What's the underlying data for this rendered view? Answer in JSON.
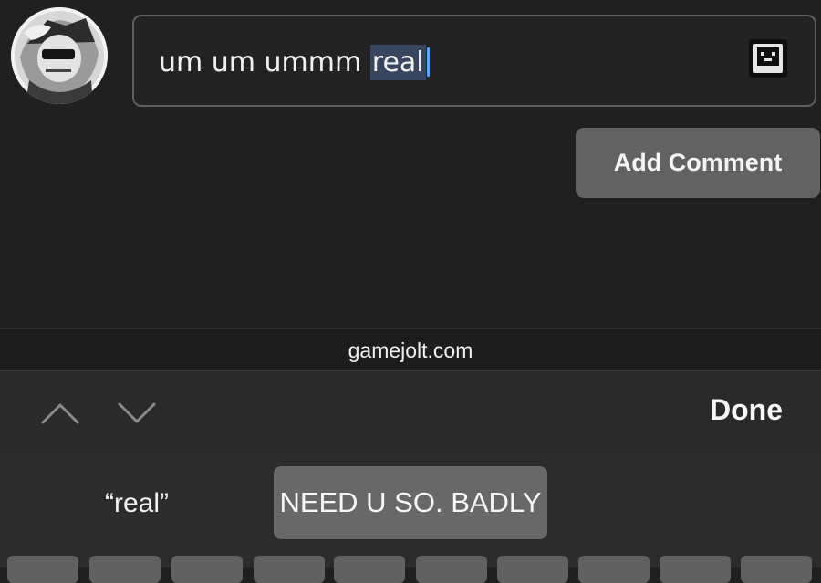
{
  "comment": {
    "text_before": "um um ummm ",
    "text_selected": "real"
  },
  "buttons": {
    "add_comment": "Add Comment",
    "done": "Done"
  },
  "browser": {
    "url": "gamejolt.com"
  },
  "keyboard": {
    "suggestion_left": "“real”",
    "suggestion_middle": "NEED U SO. BADLY"
  },
  "icons": {
    "sticker": "sticker-icon",
    "prev": "chevron-up-icon",
    "next": "chevron-down-icon"
  }
}
